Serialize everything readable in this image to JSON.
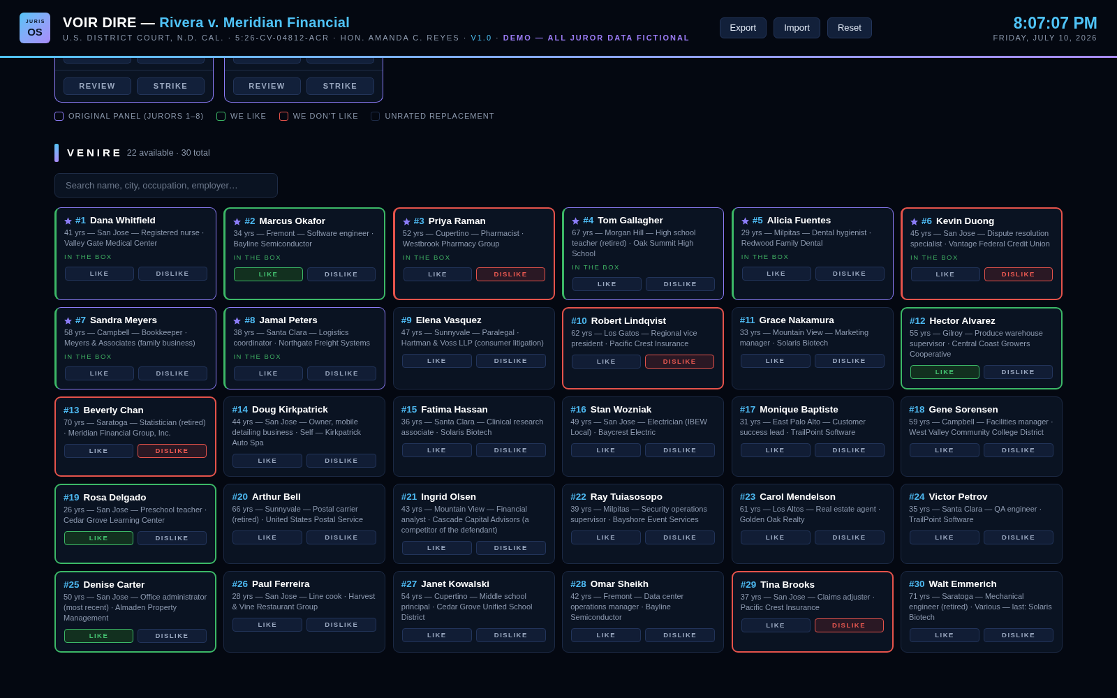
{
  "header": {
    "logo": {
      "top": "JURIS",
      "bottom": "OS"
    },
    "title": {
      "app": "VOIR DIRE —",
      "case": "Rivera v. Meridian Financial"
    },
    "subtitle": [
      {
        "kind": "plain",
        "text": "U.S. DISTRICT COURT, N.D. CAL. · 5:26-CV-04812-ACR · HON. AMANDA C. REYES ·"
      },
      {
        "kind": "version",
        "text": "V1.0"
      },
      {
        "kind": "plain",
        "text": "·"
      },
      {
        "kind": "notice",
        "text": "DEMO — ALL JUROR DATA FICTIONAL"
      }
    ],
    "actions": [
      "Export",
      "Import",
      "Reset"
    ],
    "clock": {
      "time": "8:07:07 PM",
      "date": "FRIDAY, JULY 10, 2026"
    }
  },
  "panel_cards": [
    {
      "buttons": [
        "REVIEW",
        "STRIKE"
      ]
    },
    {
      "buttons": [
        "REVIEW",
        "STRIKE"
      ]
    }
  ],
  "legend": [
    {
      "label": "ORIGINAL PANEL (JURORS 1–8)",
      "color": "#8b7cf6"
    },
    {
      "label": "WE LIKE",
      "color": "#3cb867"
    },
    {
      "label": "WE DON'T LIKE",
      "color": "#e5534b"
    },
    {
      "label": "UNRATED REPLACEMENT",
      "color": "#1e2c48"
    }
  ],
  "venire": {
    "title": "VENIRE",
    "summary": "22 available · 30 total",
    "search": {
      "placeholder": "Search name, city, occupation, employer…"
    },
    "jurors": [
      {
        "number": "#1",
        "name": "Dana Whitfield",
        "starred": true,
        "details": "41 yrs — San Jose — Registered nurse · Valley Gate Medical Center",
        "status": "IN THE BOX",
        "buttons": [
          {
            "kind": "like",
            "label": "LIKE",
            "selected": false
          },
          {
            "kind": "dislike",
            "label": "DISLIKE",
            "selected": false
          }
        ]
      },
      {
        "number": "#2",
        "name": "Marcus Okafor",
        "starred": true,
        "details": "34 yrs — Fremont — Software engineer · Bayline Semiconductor",
        "status": "IN THE BOX",
        "buttons": [
          {
            "kind": "like",
            "label": "LIKE",
            "selected": true
          },
          {
            "kind": "dislike",
            "label": "DISLIKE",
            "selected": false
          }
        ]
      },
      {
        "number": "#3",
        "name": "Priya Raman",
        "starred": true,
        "details": "52 yrs — Cupertino — Pharmacist · Westbrook Pharmacy Group",
        "status": "IN THE BOX",
        "buttons": [
          {
            "kind": "like",
            "label": "LIKE",
            "selected": false
          },
          {
            "kind": "dislike",
            "label": "DISLIKE",
            "selected": true
          }
        ]
      },
      {
        "number": "#4",
        "name": "Tom Gallagher",
        "starred": true,
        "details": "67 yrs — Morgan Hill — High school teacher (retired) · Oak Summit High School",
        "status": "IN THE BOX",
        "buttons": [
          {
            "kind": "like",
            "label": "LIKE",
            "selected": false
          },
          {
            "kind": "dislike",
            "label": "DISLIKE",
            "selected": false
          }
        ]
      },
      {
        "number": "#5",
        "name": "Alicia Fuentes",
        "starred": true,
        "details": "29 yrs — Milpitas — Dental hygienist · Redwood Family Dental",
        "status": "IN THE BOX",
        "buttons": [
          {
            "kind": "like",
            "label": "LIKE",
            "selected": false
          },
          {
            "kind": "dislike",
            "label": "DISLIKE",
            "selected": false
          }
        ]
      },
      {
        "number": "#6",
        "name": "Kevin Duong",
        "starred": true,
        "details": "45 yrs — San Jose — Dispute resolution specialist · Vantage Federal Credit Union",
        "status": "IN THE BOX",
        "buttons": [
          {
            "kind": "like",
            "label": "LIKE",
            "selected": false
          },
          {
            "kind": "dislike",
            "label": "DISLIKE",
            "selected": true
          }
        ]
      },
      {
        "number": "#7",
        "name": "Sandra Meyers",
        "starred": true,
        "details": "58 yrs — Campbell — Bookkeeper · Meyers & Associates (family business)",
        "status": "IN THE BOX",
        "buttons": [
          {
            "kind": "like",
            "label": "LIKE",
            "selected": false
          },
          {
            "kind": "dislike",
            "label": "DISLIKE",
            "selected": false
          }
        ]
      },
      {
        "number": "#8",
        "name": "Jamal Peters",
        "starred": true,
        "details": "38 yrs — Santa Clara — Logistics coordinator · Northgate Freight Systems",
        "status": "IN THE BOX",
        "buttons": [
          {
            "kind": "like",
            "label": "LIKE",
            "selected": false
          },
          {
            "kind": "dislike",
            "label": "DISLIKE",
            "selected": false
          }
        ]
      },
      {
        "number": "#9",
        "name": "Elena Vasquez",
        "starred": false,
        "details": "47 yrs — Sunnyvale — Paralegal · Hartman & Voss LLP (consumer litigation)",
        "buttons": [
          {
            "kind": "like",
            "label": "LIKE",
            "selected": false
          },
          {
            "kind": "dislike",
            "label": "DISLIKE",
            "selected": false
          }
        ]
      },
      {
        "number": "#10",
        "name": "Robert Lindqvist",
        "starred": false,
        "details": "62 yrs — Los Gatos — Regional vice president · Pacific Crest Insurance",
        "buttons": [
          {
            "kind": "like",
            "label": "LIKE",
            "selected": false
          },
          {
            "kind": "dislike",
            "label": "DISLIKE",
            "selected": true
          }
        ]
      },
      {
        "number": "#11",
        "name": "Grace Nakamura",
        "starred": false,
        "details": "33 yrs — Mountain View — Marketing manager · Solaris Biotech",
        "buttons": [
          {
            "kind": "like",
            "label": "LIKE",
            "selected": false
          },
          {
            "kind": "dislike",
            "label": "DISLIKE",
            "selected": false
          }
        ]
      },
      {
        "number": "#12",
        "name": "Hector Alvarez",
        "starred": false,
        "details": "55 yrs — Gilroy — Produce warehouse supervisor · Central Coast Growers Cooperative",
        "buttons": [
          {
            "kind": "like",
            "label": "LIKE",
            "selected": true
          },
          {
            "kind": "dislike",
            "label": "DISLIKE",
            "selected": false
          }
        ]
      },
      {
        "number": "#13",
        "name": "Beverly Chan",
        "starred": false,
        "details": "70 yrs — Saratoga — Statistician (retired) · Meridian Financial Group, Inc.",
        "buttons": [
          {
            "kind": "like",
            "label": "LIKE",
            "selected": false
          },
          {
            "kind": "dislike",
            "label": "DISLIKE",
            "selected": true
          }
        ]
      },
      {
        "number": "#14",
        "name": "Doug Kirkpatrick",
        "starred": false,
        "details": "44 yrs — San Jose — Owner, mobile detailing business · Self — Kirkpatrick Auto Spa",
        "buttons": [
          {
            "kind": "like",
            "label": "LIKE",
            "selected": false
          },
          {
            "kind": "dislike",
            "label": "DISLIKE",
            "selected": false
          }
        ]
      },
      {
        "number": "#15",
        "name": "Fatima Hassan",
        "starred": false,
        "details": "36 yrs — Santa Clara — Clinical research associate · Solaris Biotech",
        "buttons": [
          {
            "kind": "like",
            "label": "LIKE",
            "selected": false
          },
          {
            "kind": "dislike",
            "label": "DISLIKE",
            "selected": false
          }
        ]
      },
      {
        "number": "#16",
        "name": "Stan Wozniak",
        "starred": false,
        "details": "49 yrs — San Jose — Electrician (IBEW Local) · Baycrest Electric",
        "buttons": [
          {
            "kind": "like",
            "label": "LIKE",
            "selected": false
          },
          {
            "kind": "dislike",
            "label": "DISLIKE",
            "selected": false
          }
        ]
      },
      {
        "number": "#17",
        "name": "Monique Baptiste",
        "starred": false,
        "details": "31 yrs — East Palo Alto — Customer success lead · TrailPoint Software",
        "buttons": [
          {
            "kind": "like",
            "label": "LIKE",
            "selected": false
          },
          {
            "kind": "dislike",
            "label": "DISLIKE",
            "selected": false
          }
        ]
      },
      {
        "number": "#18",
        "name": "Gene Sorensen",
        "starred": false,
        "details": "59 yrs — Campbell — Facilities manager · West Valley Community College District",
        "buttons": [
          {
            "kind": "like",
            "label": "LIKE",
            "selected": false
          },
          {
            "kind": "dislike",
            "label": "DISLIKE",
            "selected": false
          }
        ]
      },
      {
        "number": "#19",
        "name": "Rosa Delgado",
        "starred": false,
        "details": "26 yrs — San Jose — Preschool teacher · Cedar Grove Learning Center",
        "buttons": [
          {
            "kind": "like",
            "label": "LIKE",
            "selected": true
          },
          {
            "kind": "dislike",
            "label": "DISLIKE",
            "selected": false
          }
        ]
      },
      {
        "number": "#20",
        "name": "Arthur Bell",
        "starred": false,
        "details": "66 yrs — Sunnyvale — Postal carrier (retired) · United States Postal Service",
        "buttons": [
          {
            "kind": "like",
            "label": "LIKE",
            "selected": false
          },
          {
            "kind": "dislike",
            "label": "DISLIKE",
            "selected": false
          }
        ]
      },
      {
        "number": "#21",
        "name": "Ingrid Olsen",
        "starred": false,
        "details": "43 yrs — Mountain View — Financial analyst · Cascade Capital Advisors (a competitor of the defendant)",
        "buttons": [
          {
            "kind": "like",
            "label": "LIKE",
            "selected": false
          },
          {
            "kind": "dislike",
            "label": "DISLIKE",
            "selected": false
          }
        ]
      },
      {
        "number": "#22",
        "name": "Ray Tuiasosopo",
        "starred": false,
        "details": "39 yrs — Milpitas — Security operations supervisor · Bayshore Event Services",
        "buttons": [
          {
            "kind": "like",
            "label": "LIKE",
            "selected": false
          },
          {
            "kind": "dislike",
            "label": "DISLIKE",
            "selected": false
          }
        ]
      },
      {
        "number": "#23",
        "name": "Carol Mendelson",
        "starred": false,
        "details": "61 yrs — Los Altos — Real estate agent · Golden Oak Realty",
        "buttons": [
          {
            "kind": "like",
            "label": "LIKE",
            "selected": false
          },
          {
            "kind": "dislike",
            "label": "DISLIKE",
            "selected": false
          }
        ]
      },
      {
        "number": "#24",
        "name": "Victor Petrov",
        "starred": false,
        "details": "35 yrs — Santa Clara — QA engineer · TrailPoint Software",
        "buttons": [
          {
            "kind": "like",
            "label": "LIKE",
            "selected": false
          },
          {
            "kind": "dislike",
            "label": "DISLIKE",
            "selected": false
          }
        ]
      },
      {
        "number": "#25",
        "name": "Denise Carter",
        "starred": false,
        "details": "50 yrs — San Jose — Office administrator (most recent) · Almaden Property Management",
        "buttons": [
          {
            "kind": "like",
            "label": "LIKE",
            "selected": true
          },
          {
            "kind": "dislike",
            "label": "DISLIKE",
            "selected": false
          }
        ]
      },
      {
        "number": "#26",
        "name": "Paul Ferreira",
        "starred": false,
        "details": "28 yrs — San Jose — Line cook · Harvest & Vine Restaurant Group",
        "buttons": [
          {
            "kind": "like",
            "label": "LIKE",
            "selected": false
          },
          {
            "kind": "dislike",
            "label": "DISLIKE",
            "selected": false
          }
        ]
      },
      {
        "number": "#27",
        "name": "Janet Kowalski",
        "starred": false,
        "details": "54 yrs — Cupertino — Middle school principal · Cedar Grove Unified School District",
        "buttons": [
          {
            "kind": "like",
            "label": "LIKE",
            "selected": false
          },
          {
            "kind": "dislike",
            "label": "DISLIKE",
            "selected": false
          }
        ]
      },
      {
        "number": "#28",
        "name": "Omar Sheikh",
        "starred": false,
        "details": "42 yrs — Fremont — Data center operations manager · Bayline Semiconductor",
        "buttons": [
          {
            "kind": "like",
            "label": "LIKE",
            "selected": false
          },
          {
            "kind": "dislike",
            "label": "DISLIKE",
            "selected": false
          }
        ]
      },
      {
        "number": "#29",
        "name": "Tina Brooks",
        "starred": false,
        "details": "37 yrs — San Jose — Claims adjuster · Pacific Crest Insurance",
        "buttons": [
          {
            "kind": "like",
            "label": "LIKE",
            "selected": false
          },
          {
            "kind": "dislike",
            "label": "DISLIKE",
            "selected": true
          }
        ]
      },
      {
        "number": "#30",
        "name": "Walt Emmerich",
        "starred": false,
        "details": "71 yrs — Saratoga — Mechanical engineer (retired) · Various — last: Solaris Biotech",
        "buttons": [
          {
            "kind": "like",
            "label": "LIKE",
            "selected": false
          },
          {
            "kind": "dislike",
            "label": "DISLIKE",
            "selected": false
          }
        ]
      }
    ]
  }
}
